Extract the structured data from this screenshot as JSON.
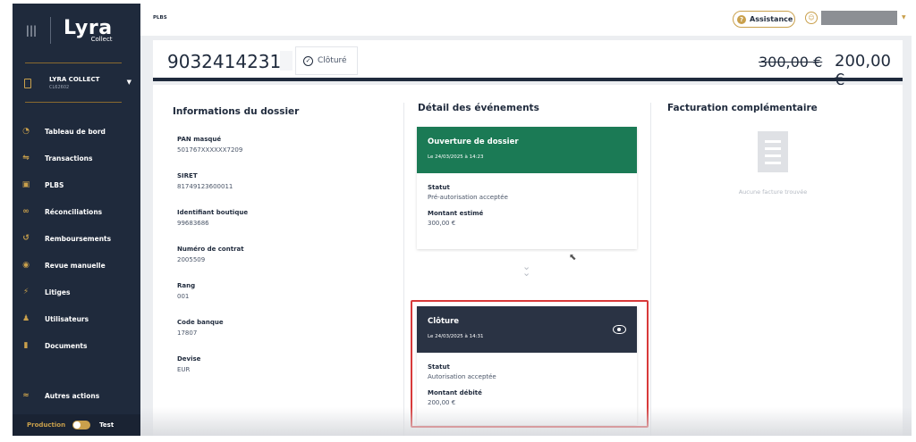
{
  "sidebar": {
    "logo_main": "Lyra",
    "logo_sub": "Collect",
    "merchant_name": "LYRA COLLECT",
    "merchant_code": "CL62602",
    "nav": [
      {
        "label": "Tableau de bord",
        "icon": "gauge-icon",
        "glyph": "◔"
      },
      {
        "label": "Transactions",
        "icon": "transactions-icon",
        "glyph": "⇋"
      },
      {
        "label": "PLBS",
        "icon": "briefcase-icon",
        "glyph": "▣"
      },
      {
        "label": "Réconciliations",
        "icon": "link-icon",
        "glyph": "∞"
      },
      {
        "label": "Remboursements",
        "icon": "refund-icon",
        "glyph": "↺"
      },
      {
        "label": "Revue manuelle",
        "icon": "eye-icon",
        "glyph": "◉"
      },
      {
        "label": "Litiges",
        "icon": "gavel-icon",
        "glyph": "⚡"
      },
      {
        "label": "Utilisateurs",
        "icon": "users-icon",
        "glyph": "♟"
      },
      {
        "label": "Documents",
        "icon": "document-icon",
        "glyph": "▮"
      }
    ],
    "autres": {
      "label": "Autres actions",
      "icon": "sliders-icon",
      "glyph": "≈"
    },
    "env_production": "Production",
    "env_test": "Test"
  },
  "topbar": {
    "breadcrumb": "PLBS",
    "assistance": "Assistance"
  },
  "header": {
    "dossier_id": "90324142318",
    "status": "Clôturé",
    "amount_old": "300,00 €",
    "amount_new": "200,00 €"
  },
  "info": {
    "title": "Informations du dossier",
    "fields": [
      {
        "label": "PAN masqué",
        "value": "501767XXXXXX7209"
      },
      {
        "label": "SIRET",
        "value": "81749123600011"
      },
      {
        "label": "Identifiant boutique",
        "value": "99683686"
      },
      {
        "label": "Numéro de contrat",
        "value": "2005509"
      },
      {
        "label": "Rang",
        "value": "001"
      },
      {
        "label": "Code banque",
        "value": "17807"
      },
      {
        "label": "Devise",
        "value": "EUR"
      }
    ]
  },
  "events": {
    "title": "Détail des événements",
    "opening": {
      "title": "Ouverture de dossier",
      "date": "Le 24/03/2025 à 14:23",
      "status_label": "Statut",
      "status_value": "Pré-autorisation acceptée",
      "amount_label": "Montant estimé",
      "amount_value": "300,00 €",
      "color": "#1b7a55"
    },
    "closing": {
      "title": "Clôture",
      "date": "Le 24/03/2025 à 14:31",
      "status_label": "Statut",
      "status_value": "Autorisation acceptée",
      "amount_label": "Montant débité",
      "amount_value": "200,00 €",
      "color": "#2a3344"
    }
  },
  "billing": {
    "title": "Facturation complémentaire",
    "empty_text": "Aucune facture trouvée"
  }
}
